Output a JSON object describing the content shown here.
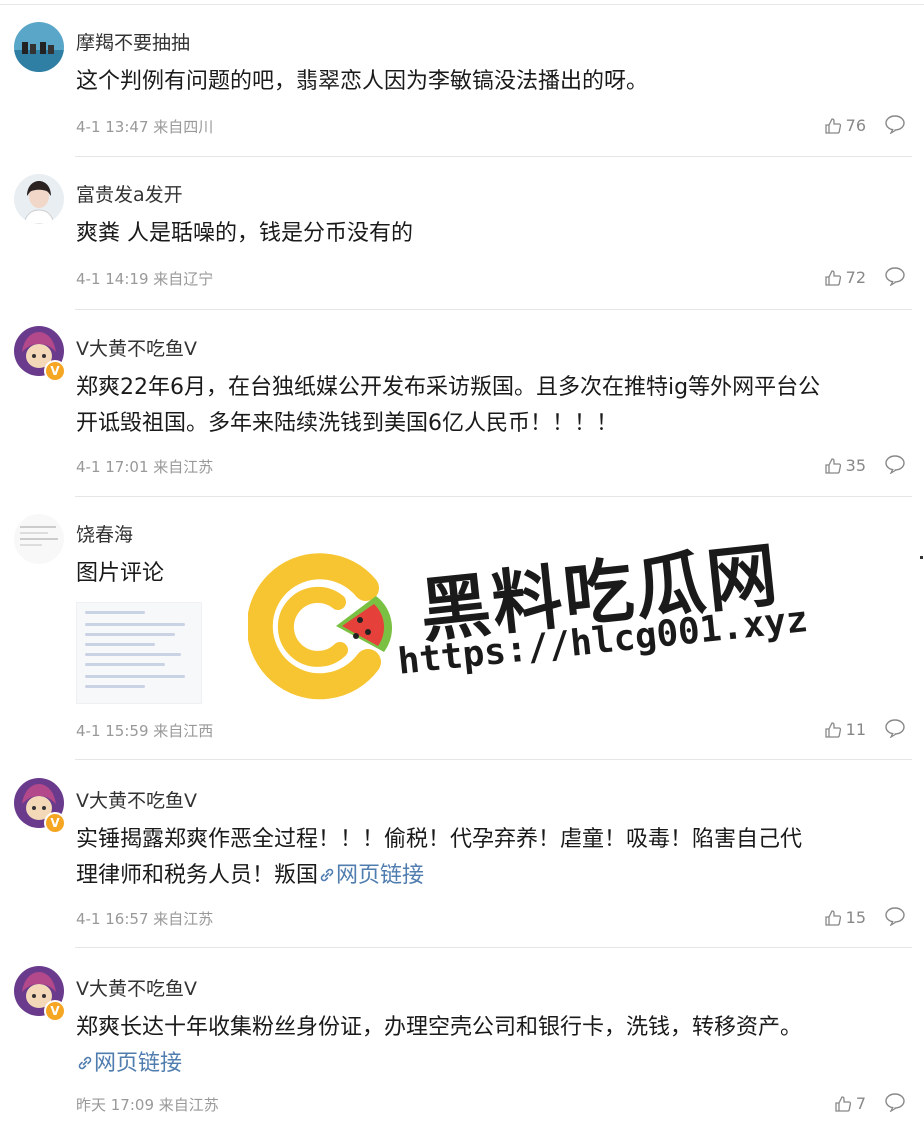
{
  "comments": [
    {
      "username": "摩羯不要抽抽",
      "text": "这个判例有问题的吧，翡翠恋人因为李敏镐没法播出的呀。",
      "meta": "4-1 13:47 来自四川",
      "likes": "76",
      "avatar": "photo-avatar"
    },
    {
      "username": "富贵发a发开",
      "text": "爽粪 人是聒噪的，钱是分币没有的",
      "meta": "4-1 14:19 来自辽宁",
      "likes": "72",
      "avatar": "photo-avatar"
    },
    {
      "username": "V大黄不吃鱼V",
      "text_line1": "郑爽22年6月，在台独纸媒公开发布采访叛国。且多次在推特ig等外网平台公",
      "text_line2": "开诋毁祖国。多年来陆续洗钱到美国6亿人民币！！！！",
      "meta": "4-1 17:01 来自江苏",
      "likes": "35",
      "badge": "V"
    },
    {
      "username": "饶春海",
      "text": "图片评论",
      "meta": "4-1 15:59 来自江西",
      "likes": "11"
    },
    {
      "username": "V大黄不吃鱼V",
      "text_line1": "实锤揭露郑爽作恶全过程！！！偷税！代孕弃养！虐童！吸毒！陷害自己代",
      "text_line2": "理律师和税务人员！叛国",
      "link": "网页链接",
      "meta": "4-1 16:57 来自江苏",
      "likes": "15",
      "badge": "V"
    },
    {
      "username": "V大黄不吃鱼V",
      "text_line1": "郑爽长达十年收集粉丝身份证，办理空壳公司和银行卡，洗钱，转移资产。",
      "link": "网页链接",
      "meta": "昨天 17:09 来自江苏",
      "likes": "7",
      "badge": "V"
    }
  ],
  "watermark": {
    "title": "黑料吃瓜网",
    "url": "https://hlcg001.xyz"
  },
  "colors": {
    "link": "#507daf",
    "meta": "#999999",
    "badge": "#f5a623",
    "logo_yellow": "#f7c531",
    "logo_green": "#7ac143",
    "logo_red": "#e5403a"
  }
}
